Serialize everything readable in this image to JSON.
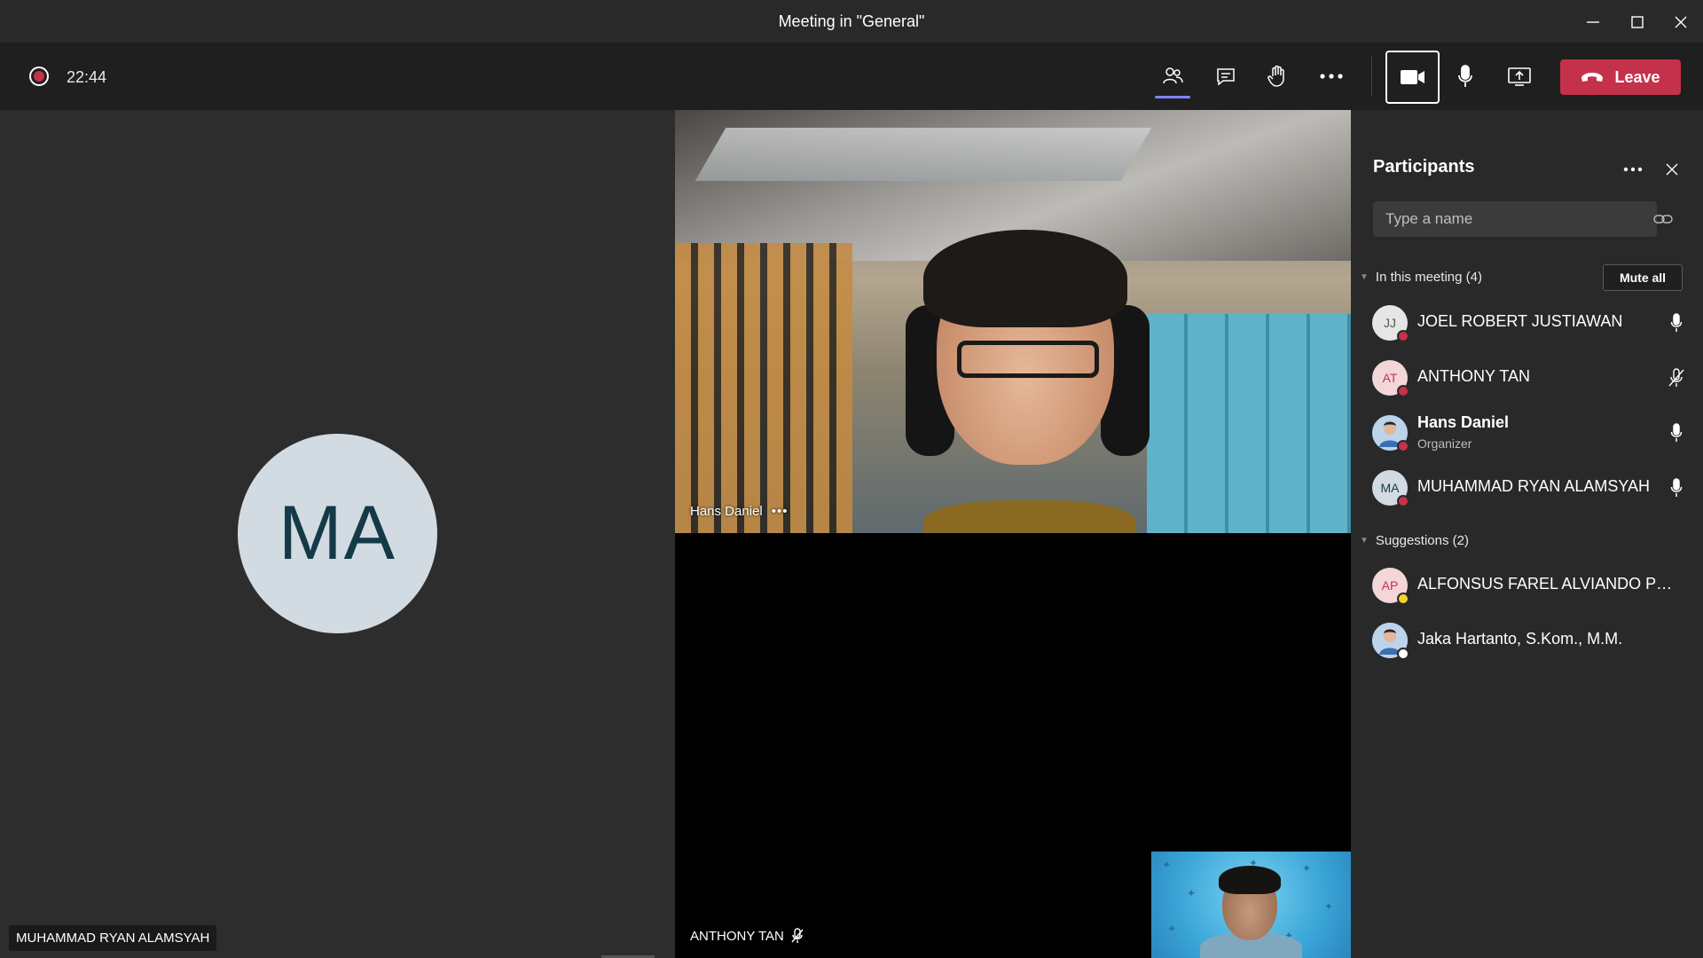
{
  "window": {
    "title": "Meeting in \"General\""
  },
  "toolbar": {
    "timer": "22:44",
    "leave_label": "Leave",
    "leave_color": "#c4314b",
    "accent": "#7f85f5"
  },
  "stage": {
    "left_tile": {
      "initials": "MA",
      "name": "MUHAMMAD RYAN ALAMSYAH"
    },
    "top_video": {
      "name": "Hans Daniel",
      "more": "•••"
    },
    "bottom_video": {
      "name": "ANTHONY TAN"
    }
  },
  "panel": {
    "title": "Participants",
    "search_placeholder": "Type a name",
    "in_meeting_label": "In this meeting (4)",
    "mute_all_label": "Mute all",
    "suggestions_label": "Suggestions (2)",
    "participants": [
      {
        "initials": "JJ",
        "name": "JOEL ROBERT JUSTIAWAN",
        "role": "",
        "mic": "on",
        "avatar_bg": "#e6e6e6",
        "avatar_fg": "#555555",
        "status_color": "#c4314b"
      },
      {
        "initials": "AT",
        "name": "ANTHONY TAN",
        "role": "",
        "mic": "off",
        "avatar_bg": "#f3d6d8",
        "avatar_fg": "#c4314b",
        "status_color": "#c4314b"
      },
      {
        "initials": "",
        "name": "Hans Daniel",
        "role": "Organizer",
        "mic": "on",
        "avatar_bg": "#4a7fc1",
        "avatar_fg": "#ffffff",
        "status_color": "#c4314b"
      },
      {
        "initials": "MA",
        "name": "MUHAMMAD RYAN ALAMSYAH",
        "role": "",
        "mic": "on",
        "avatar_bg": "#d2dbe1",
        "avatar_fg": "#143a47",
        "status_color": "#c4314b"
      }
    ],
    "suggestions": [
      {
        "initials": "AP",
        "name": "ALFONSUS FAREL ALVIANDO PRATA...",
        "avatar_bg": "#f3d6d8",
        "avatar_fg": "#c4314b",
        "status_color": "#f8d22a"
      },
      {
        "initials": "",
        "name": "Jaka Hartanto, S.Kom., M.M.",
        "avatar_bg": "#e0e0e0",
        "avatar_fg": "#555555",
        "status_color": "#ffffff"
      }
    ]
  }
}
